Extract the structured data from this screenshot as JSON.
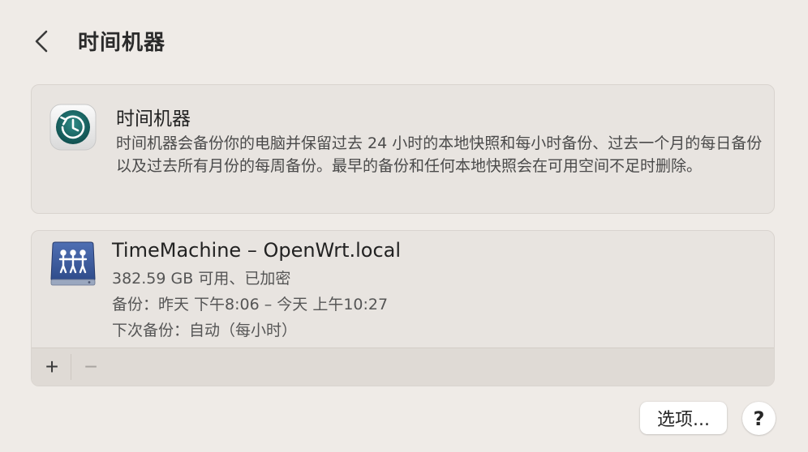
{
  "header": {
    "back_icon": "chevron-left-icon",
    "title": "时间机器"
  },
  "info_card": {
    "icon": "time-machine-icon",
    "title": "时间机器",
    "description": "时间机器会备份你的电脑并保留过去 24 小时的本地快照和每小时备份、过去一个月的每日备份以及过去所有月份的每周备份。最早的备份和任何本地快照会在可用空间不足时删除。"
  },
  "backup_disk": {
    "icon": "network-disk-icon",
    "name": "TimeMachine – OpenWrt.local",
    "space": "382.59 GB 可用、已加密",
    "last_backup": "备份：昨天 下午8:06 – 今天 上午10:27",
    "next_backup": "下次备份：自动（每小时）"
  },
  "toolbar": {
    "add_label": "+",
    "remove_label": "−"
  },
  "footer": {
    "options_label": "选项...",
    "help_label": "?"
  },
  "colors": {
    "background": "#efebe7",
    "card": "#e8e4e0",
    "time_machine_teal": "#1e6b6b",
    "disk_blue": "#3a5a9a"
  }
}
